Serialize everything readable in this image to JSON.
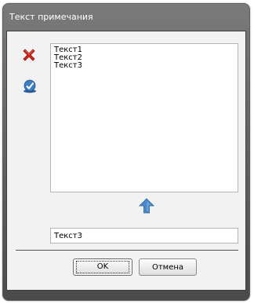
{
  "window": {
    "title": "Текст примечания"
  },
  "toolbar": {
    "delete_icon": "red-x-delete-icon",
    "apply_icon": "blue-check-icon"
  },
  "list": {
    "items": [
      "Текст1",
      "Текст2",
      "Текст3"
    ]
  },
  "move_up_icon": "blue-up-arrow-icon",
  "input": {
    "value": "Текст3",
    "placeholder": ""
  },
  "buttons": {
    "ok_label": "OK",
    "cancel_label": "Отмена"
  },
  "colors": {
    "titlebar": "#6a6a6a",
    "client_background": "#f2f2f2",
    "delete_red": "#d0281c",
    "accent_blue": "#3b7fc4"
  }
}
